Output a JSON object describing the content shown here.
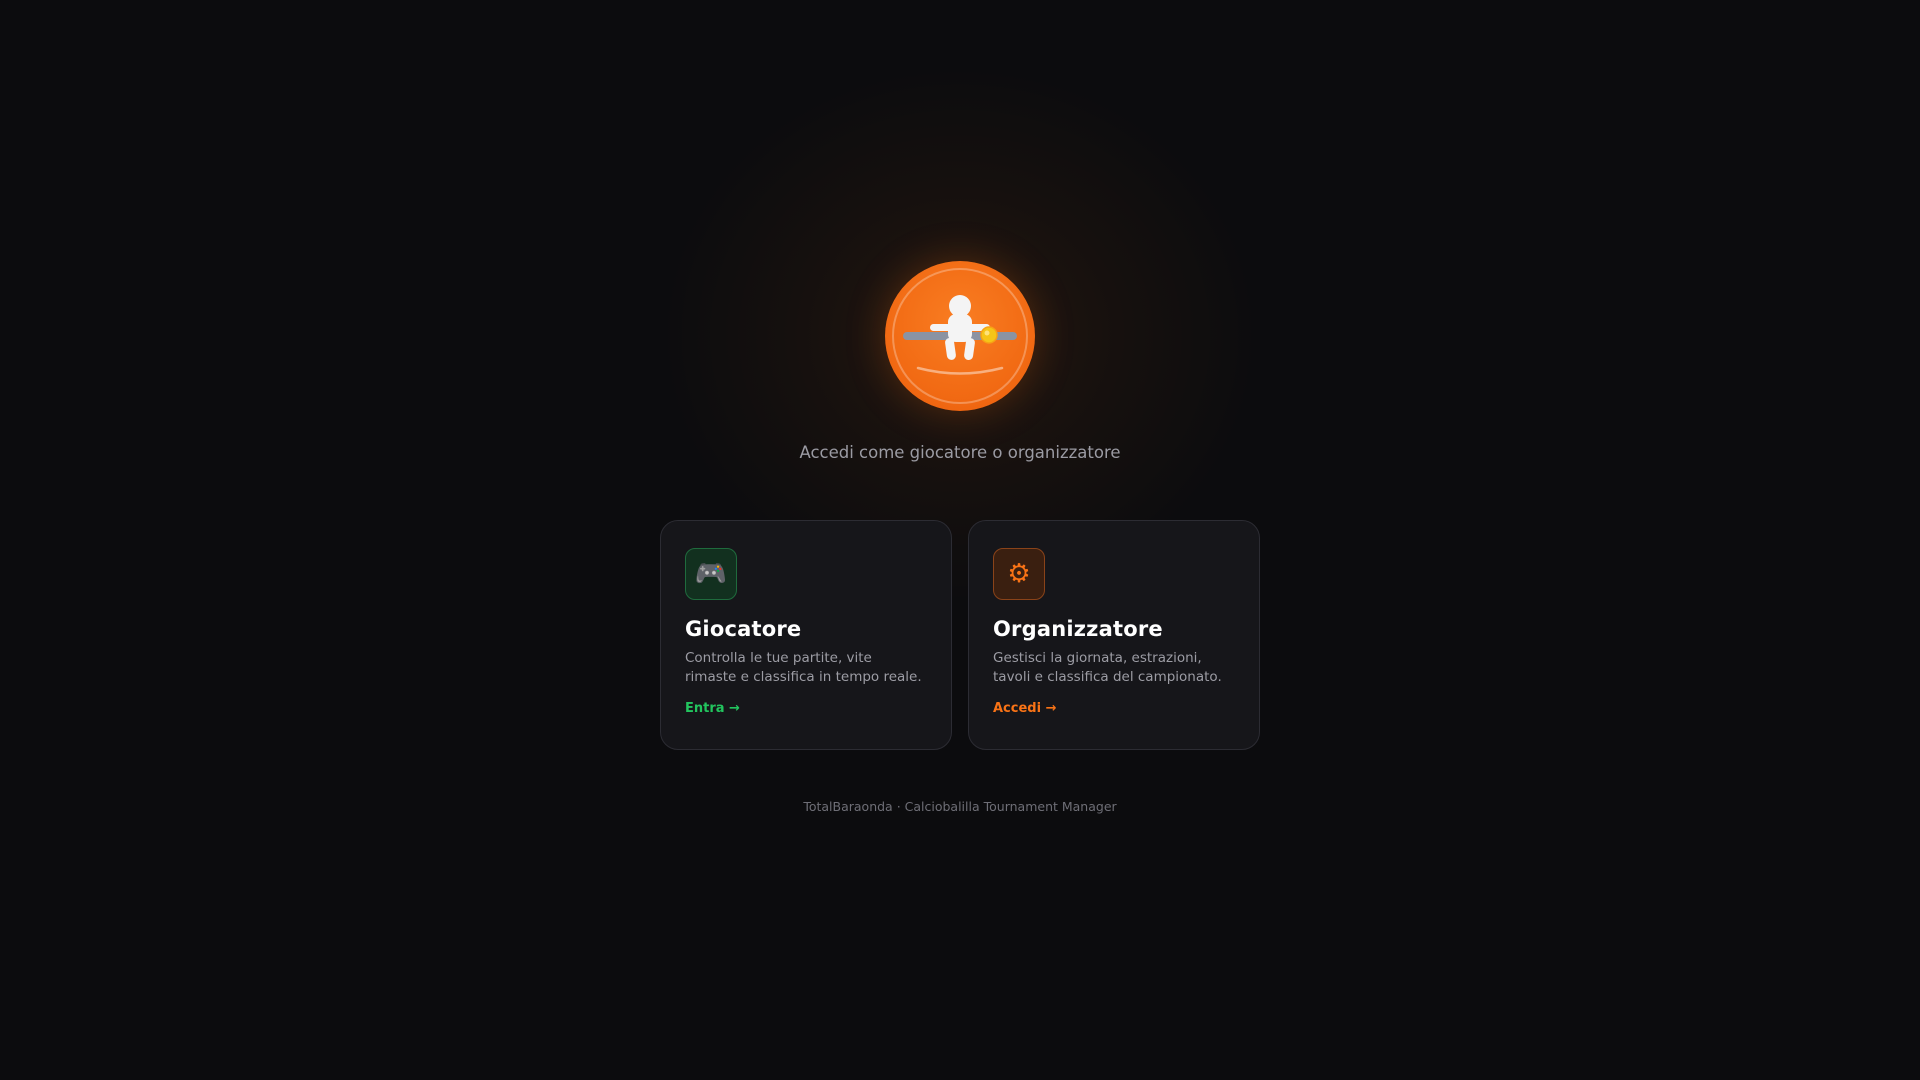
{
  "header": {
    "logo_icon": "foosball-player-logo",
    "subtitle": "Accedi come giocatore o organizzatore"
  },
  "cards": [
    {
      "icon": "gamepad-icon",
      "icon_glyph": "🎮",
      "title": "Giocatore",
      "description": "Controlla le tue partite, vite rimaste e classifica in tempo reale.",
      "link": "Entra →",
      "accent": "#22c55e"
    },
    {
      "icon": "gear-icon",
      "icon_glyph": "⚙",
      "title": "Organizzatore",
      "description": "Gestisci la giornata, estrazioni, tavoli e classifica del campionato.",
      "link": "Accedi →",
      "accent": "#f97316"
    }
  ],
  "footer": {
    "text": "TotalBaraonda · Calciobalilla Tournament Manager"
  },
  "colors": {
    "background": "#0c0c0e",
    "brand_orange": "#f97316",
    "green": "#22c55e"
  }
}
